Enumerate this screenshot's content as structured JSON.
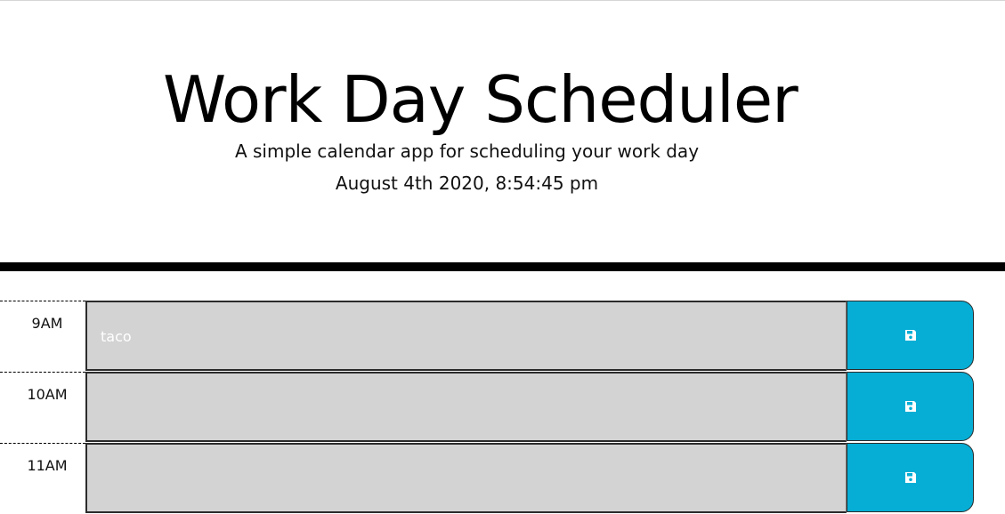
{
  "header": {
    "title": "Work Day Scheduler",
    "lead": "A simple calendar app for scheduling your work day",
    "current_day": "August 4th 2020, 8:54:45 pm"
  },
  "colors": {
    "past_block": "#d3d3d3",
    "save_button": "#06aed5",
    "divider": "#000000"
  },
  "time_blocks": [
    {
      "hour": "9AM",
      "description": "taco",
      "save_icon": "floppy-disk-icon"
    },
    {
      "hour": "10AM",
      "description": "",
      "save_icon": "floppy-disk-icon"
    },
    {
      "hour": "11AM",
      "description": "",
      "save_icon": "floppy-disk-icon"
    }
  ]
}
